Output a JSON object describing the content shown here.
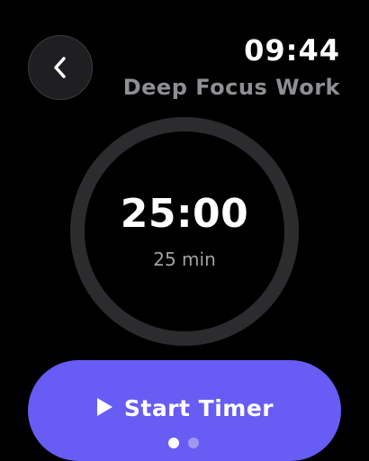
{
  "header": {
    "clock": "09:44",
    "session_title": "Deep Focus Work"
  },
  "back_button": {
    "icon": "chevron-left-icon"
  },
  "timer": {
    "time_display": "25:00",
    "duration_label": "25 min",
    "progress": 0
  },
  "start_button": {
    "icon": "play-icon",
    "label": "Start Timer"
  },
  "pagination": {
    "pages": 2,
    "current_page": 1
  },
  "colors": {
    "background": "#000000",
    "ring_track": "#2c2c2e",
    "accent": "#675cf3",
    "secondary_text": "#8e8e93"
  }
}
